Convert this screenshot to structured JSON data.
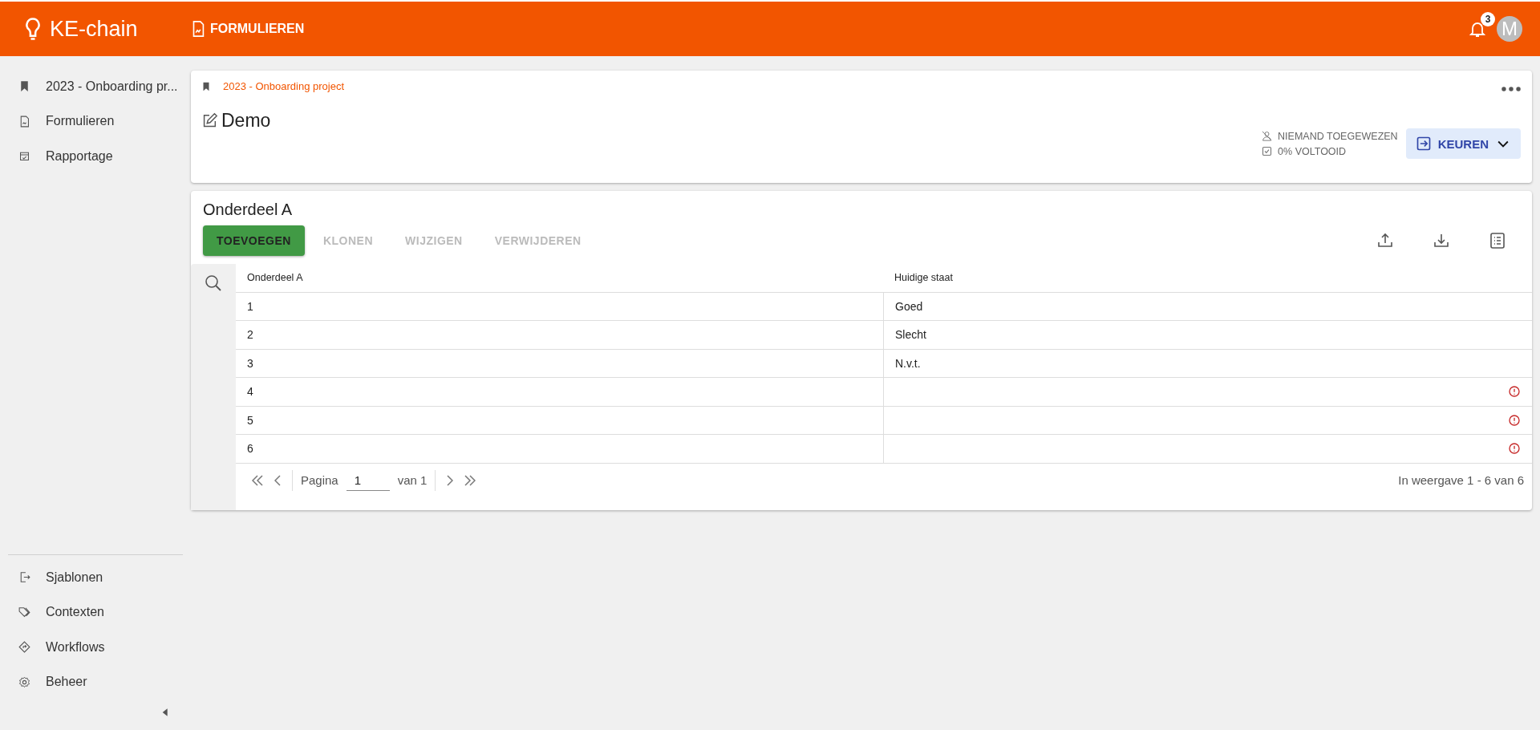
{
  "header": {
    "logo": "KE-chain",
    "section": "FORMULIEREN",
    "notifications": "3",
    "avatar": "M"
  },
  "sidebar": {
    "items": [
      {
        "label": "2023 - Onboarding pr..."
      },
      {
        "label": "Formulieren"
      },
      {
        "label": "Rapportage"
      }
    ],
    "bottom_items": [
      {
        "label": "Sjablonen"
      },
      {
        "label": "Contexten"
      },
      {
        "label": "Workflows"
      },
      {
        "label": "Beheer"
      }
    ]
  },
  "task": {
    "breadcrumb": "2023 - Onboarding project",
    "title": "Demo",
    "assignee": "NIEMAND TOEGEWEZEN",
    "progress": "0% VOLTOOID",
    "action": "KEUREN"
  },
  "grid": {
    "title": "Onderdeel A",
    "buttons": [
      {
        "label": "TOEVOEGEN",
        "disabled": false
      },
      {
        "label": "KLONEN",
        "disabled": true
      },
      {
        "label": "WIJZIGEN",
        "disabled": true
      },
      {
        "label": "VERWIJDEREN",
        "disabled": true
      }
    ],
    "columns": [
      "Onderdeel A",
      "Huidige staat"
    ],
    "rows": [
      {
        "cells": [
          "1",
          "Goed"
        ],
        "invalid": false
      },
      {
        "cells": [
          "2",
          "Slecht"
        ],
        "invalid": false
      },
      {
        "cells": [
          "3",
          "N.v.t."
        ],
        "invalid": false
      },
      {
        "cells": [
          "4",
          ""
        ],
        "invalid": true
      },
      {
        "cells": [
          "5",
          ""
        ],
        "invalid": true
      },
      {
        "cells": [
          "6",
          ""
        ],
        "invalid": true
      }
    ],
    "pagination": {
      "label": "Pagina",
      "page": "1",
      "of": "van 1",
      "summary": "In weergave 1 - 6 van 6"
    }
  }
}
